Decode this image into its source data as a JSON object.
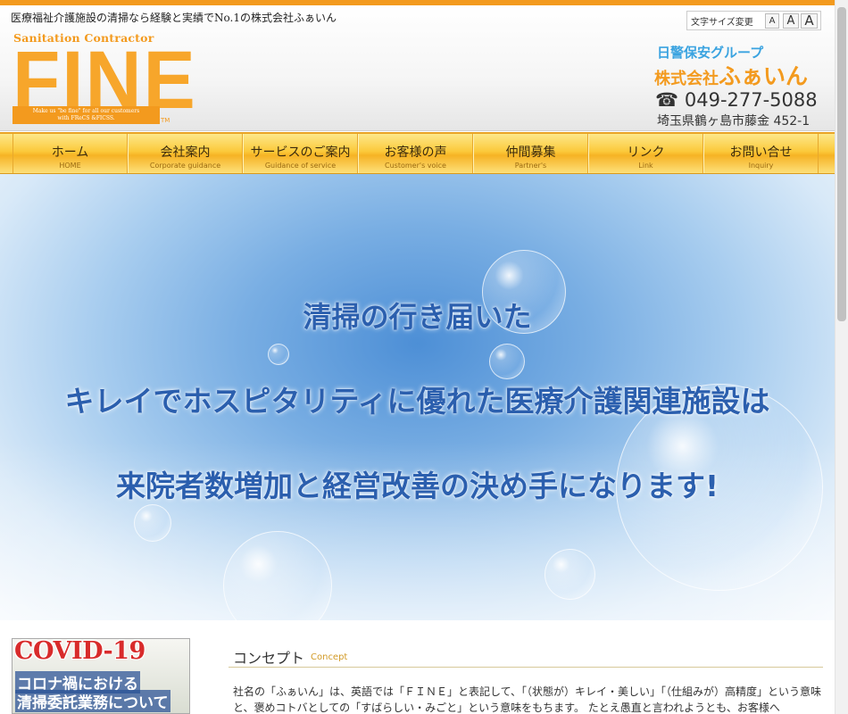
{
  "header": {
    "tagline": "医療福祉介護施設の清掃なら経験と実績でNo.1の株式会社ふぁいん",
    "font_size_label": "文字サイズ変更",
    "font_sizes": [
      "A",
      "A",
      "A"
    ],
    "logo": {
      "subtitle": "Sanitation Contractor",
      "word": "FINE",
      "band_line1": "Make us \"be fine\" for all our customers",
      "band_line2": "with FReCS &FICSS.",
      "tm": "TM"
    },
    "group": "日警保安グループ",
    "company_prefix": "株式会社",
    "company_name": "ふぁいん",
    "phone_icon": "☎",
    "phone": "049-277-5088",
    "address": "埼玉県鶴ヶ島市藤金 452-1"
  },
  "nav": [
    {
      "ja": "ホーム",
      "en": "HOME"
    },
    {
      "ja": "会社案内",
      "en": "Corporate guidance"
    },
    {
      "ja": "サービスのご案内",
      "en": "Guidance of service"
    },
    {
      "ja": "お客様の声",
      "en": "Customer's voice"
    },
    {
      "ja": "仲間募集",
      "en": "Partner's"
    },
    {
      "ja": "リンク",
      "en": "Link"
    },
    {
      "ja": "お問い合せ",
      "en": "Inquiry"
    }
  ],
  "hero": {
    "line1": "清掃の行き届いた",
    "line2": "キレイでホスピタリティに優れた医療介護関連施設は",
    "line3": "来院者数増加と経営改善の決め手になります!"
  },
  "banner": {
    "title": "COVID-19",
    "line2": "コロナ禍における",
    "line3": "清掃委託業務について"
  },
  "concept": {
    "title_ja": "コンセプト",
    "title_en": "Concept",
    "body": "社名の「ふぁいん」は、英語では「ＦＩＮＥ」と表記して、「（状態が）キレイ・美しい」「（仕組みが）高精度」という意味と、褒めコトバとしての「すばらしい・みごと」という意味をもちます。 たとえ愚直と言われようとも、お客様へ"
  },
  "colors": {
    "accent": "#f39a1e",
    "nav": "#fbc93a",
    "hero_text": "#2b5fae",
    "group_blue": "#3aa3e0",
    "covid_red": "#d82b2b"
  }
}
